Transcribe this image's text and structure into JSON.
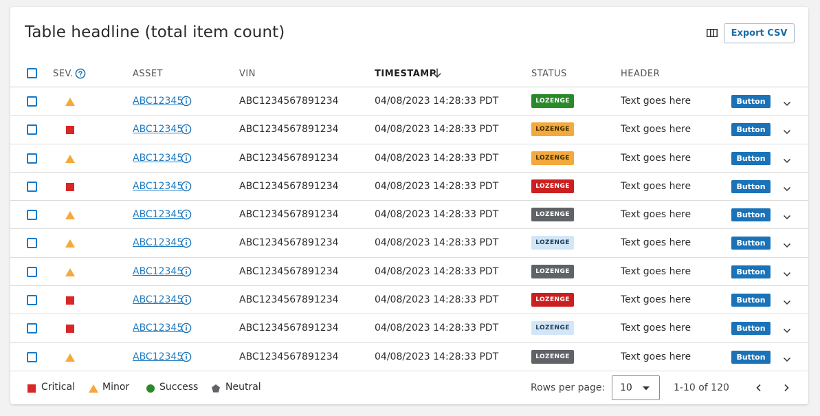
{
  "colors": {
    "primary": "#1a73b8",
    "link": "#1f7bc1",
    "critical": "#d92626",
    "minor": "#f3a93c",
    "success": "#2a8a2a",
    "neutral": "#5f6368"
  },
  "table": {
    "headline": "Table headline (total item count)",
    "columns_icon": "columns-icon",
    "export_label": "Export CSV",
    "columns": {
      "sev": "SEV.",
      "asset": "ASSET",
      "vin": "VIN",
      "timestamp": "TIMESTAMP",
      "status": "STATUS",
      "header": "HEADER"
    },
    "sort": {
      "column": "timestamp",
      "direction": "descending"
    }
  },
  "rows": [
    {
      "sev": "minor",
      "asset": "ABC12345",
      "vin": "ABC1234567891234",
      "timestamp": "04/08/2023 14:28:33 PDT",
      "status": {
        "label": "LOZENGE",
        "variant": "success"
      },
      "header": "Text goes here",
      "button": "Button"
    },
    {
      "sev": "critical",
      "asset": "ABC12345",
      "vin": "ABC1234567891234",
      "timestamp": "04/08/2023 14:28:33 PDT",
      "status": {
        "label": "LOZENGE",
        "variant": "warning"
      },
      "header": "Text goes here",
      "button": "Button"
    },
    {
      "sev": "minor",
      "asset": "ABC12345",
      "vin": "ABC1234567891234",
      "timestamp": "04/08/2023 14:28:33 PDT",
      "status": {
        "label": "LOZENGE",
        "variant": "warning"
      },
      "header": "Text goes here",
      "button": "Button"
    },
    {
      "sev": "critical",
      "asset": "ABC12345",
      "vin": "ABC1234567891234",
      "timestamp": "04/08/2023 14:28:33 PDT",
      "status": {
        "label": "LOZENGE",
        "variant": "critical"
      },
      "header": "Text goes here",
      "button": "Button"
    },
    {
      "sev": "minor",
      "asset": "ABC12345",
      "vin": "ABC1234567891234",
      "timestamp": "04/08/2023 14:28:33 PDT",
      "status": {
        "label": "LOZENGE",
        "variant": "neutral"
      },
      "header": "Text goes here",
      "button": "Button"
    },
    {
      "sev": "minor",
      "asset": "ABC12345",
      "vin": "ABC1234567891234",
      "timestamp": "04/08/2023 14:28:33 PDT",
      "status": {
        "label": "LOZENGE",
        "variant": "info"
      },
      "header": "Text goes here",
      "button": "Button"
    },
    {
      "sev": "minor",
      "asset": "ABC12345",
      "vin": "ABC1234567891234",
      "timestamp": "04/08/2023 14:28:33 PDT",
      "status": {
        "label": "LOZENGE",
        "variant": "neutral"
      },
      "header": "Text goes here",
      "button": "Button"
    },
    {
      "sev": "critical",
      "asset": "ABC12345",
      "vin": "ABC1234567891234",
      "timestamp": "04/08/2023 14:28:33 PDT",
      "status": {
        "label": "LOZENGE",
        "variant": "critical"
      },
      "header": "Text goes here",
      "button": "Button"
    },
    {
      "sev": "critical",
      "asset": "ABC12345",
      "vin": "ABC1234567891234",
      "timestamp": "04/08/2023 14:28:33 PDT",
      "status": {
        "label": "LOZENGE",
        "variant": "info"
      },
      "header": "Text goes here",
      "button": "Button"
    },
    {
      "sev": "minor",
      "asset": "ABC12345",
      "vin": "ABC1234567891234",
      "timestamp": "04/08/2023 14:28:33 PDT",
      "status": {
        "label": "LOZENGE",
        "variant": "neutral"
      },
      "header": "Text goes here",
      "button": "Button"
    }
  ],
  "lozenge_styles": {
    "success": {
      "bg": "#2a8a2a",
      "fg": "#ffffff"
    },
    "warning": {
      "bg": "#f3a93c",
      "fg": "#3a2a00"
    },
    "critical": {
      "bg": "#cc1f1f",
      "fg": "#ffffff"
    },
    "neutral": {
      "bg": "#5f6368",
      "fg": "#ffffff"
    },
    "info": {
      "bg": "#d3e6f7",
      "fg": "#1d3b55"
    }
  },
  "legend": [
    {
      "icon": "critical-square-icon",
      "label": "Critical"
    },
    {
      "icon": "minor-triangle-icon",
      "label": "Minor"
    },
    {
      "icon": "success-circle-icon",
      "label": "Success"
    },
    {
      "icon": "neutral-pentagon-icon",
      "label": "Neutral"
    }
  ],
  "pagination": {
    "rows_per_page_label": "Rows per page:",
    "rows_per_page_value": "10",
    "range_text": "1-10 of 120"
  }
}
